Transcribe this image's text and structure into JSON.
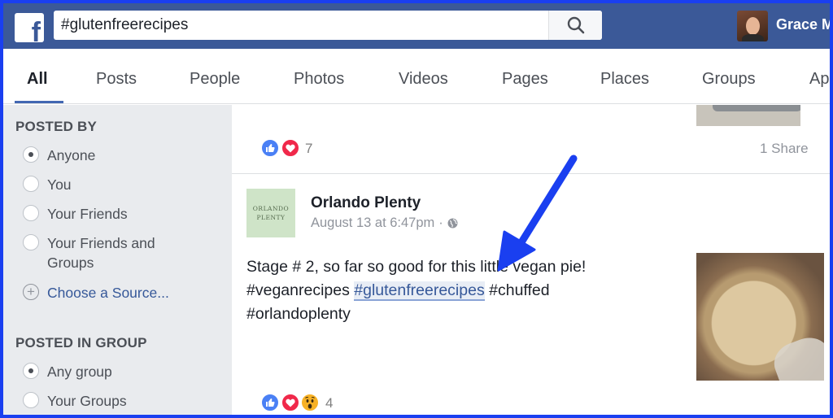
{
  "header": {
    "search_value": "#glutenfreerecipes",
    "user_name": "Grace M"
  },
  "tabs": [
    "All",
    "Posts",
    "People",
    "Photos",
    "Videos",
    "Pages",
    "Places",
    "Groups",
    "Ap"
  ],
  "sidebar": {
    "posted_by": {
      "title": "POSTED BY",
      "options": [
        "Anyone",
        "You",
        "Your Friends",
        "Your Friends and Groups"
      ],
      "selected": "Anyone",
      "choose_source": "Choose a Source..."
    },
    "posted_in_group": {
      "title": "POSTED IN GROUP",
      "options": [
        "Any group",
        "Your Groups"
      ],
      "selected": "Any group"
    }
  },
  "feed": {
    "prev_post": {
      "reaction_count": "7",
      "share_count": "1 Share"
    },
    "post": {
      "avatar_text_1": "ORLANDO",
      "avatar_text_2": "PLENTY",
      "author": "Orlando Plenty",
      "timestamp": "August 13 at 6:47pm",
      "separator": "·",
      "body_line1": "Stage # 2, so far so good for this little vegan pie!",
      "tag1": "#veganrecipes",
      "tag2": "#glutenfreerecipes",
      "tag3": "#chuffed",
      "tag4": "#orlandoplenty",
      "reaction_count": "4"
    }
  },
  "colors": {
    "facebook_blue": "#3b5998",
    "annotation_border": "#1a3ff0",
    "annotation_arrow": "#1a3ff0"
  }
}
